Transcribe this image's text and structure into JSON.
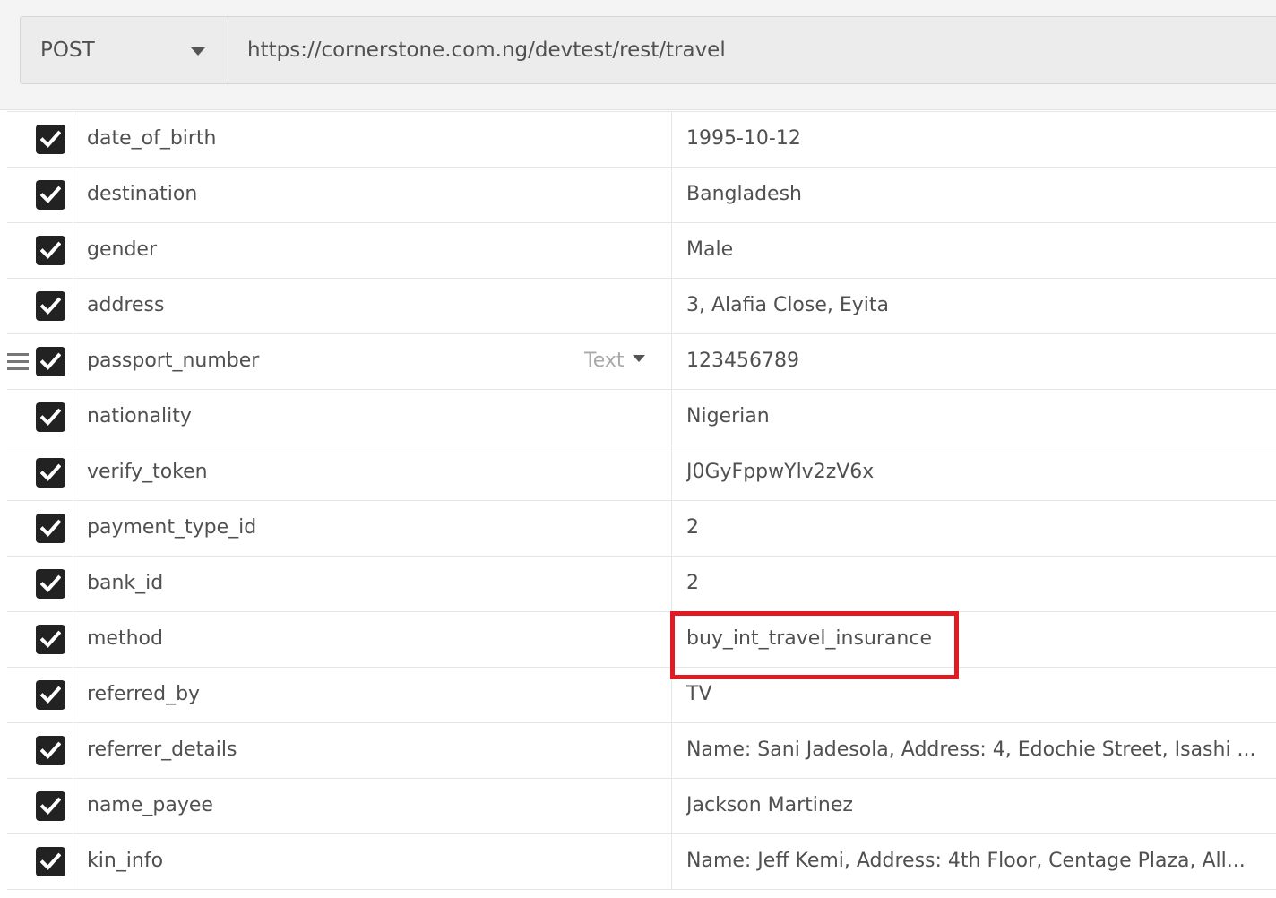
{
  "request": {
    "method": "POST",
    "url": "https://cornerstone.com.ng/devtest/rest/travel"
  },
  "params": [
    {
      "key": "date_of_birth",
      "value": "1995-10-12",
      "checked": true
    },
    {
      "key": "destination",
      "value": "Bangladesh",
      "checked": true
    },
    {
      "key": "gender",
      "value": "Male",
      "checked": true
    },
    {
      "key": "address",
      "value": "3, Alafia Close, Eyita",
      "checked": true
    },
    {
      "key": "passport_number",
      "value": "123456789",
      "checked": true,
      "type": "Text"
    },
    {
      "key": "nationality",
      "value": "Nigerian",
      "checked": true
    },
    {
      "key": "verify_token",
      "value": "J0GyFppwYlv2zV6x",
      "checked": true
    },
    {
      "key": "payment_type_id",
      "value": "2",
      "checked": true
    },
    {
      "key": "bank_id",
      "value": "2",
      "checked": true
    },
    {
      "key": "method",
      "value": "buy_int_travel_insurance",
      "checked": true
    },
    {
      "key": "referred_by",
      "value": "TV",
      "checked": true
    },
    {
      "key": "referrer_details",
      "value": "Name: Sani  Jadesola, Address: 4, Edochie Street, Isashi ...",
      "checked": true
    },
    {
      "key": "name_payee",
      "value": "Jackson Martinez",
      "checked": true
    },
    {
      "key": "kin_info",
      "value": "Name: Jeff  Kemi, Address: 4th Floor, Centage Plaza, All...",
      "checked": true
    }
  ],
  "colors": {
    "highlight": "#e01b23",
    "checkbox": "#222222"
  },
  "icons": {
    "method_dropdown": "caret-down-icon",
    "checkbox": "checkmark-icon",
    "row_handle": "drag-handle-icon"
  }
}
